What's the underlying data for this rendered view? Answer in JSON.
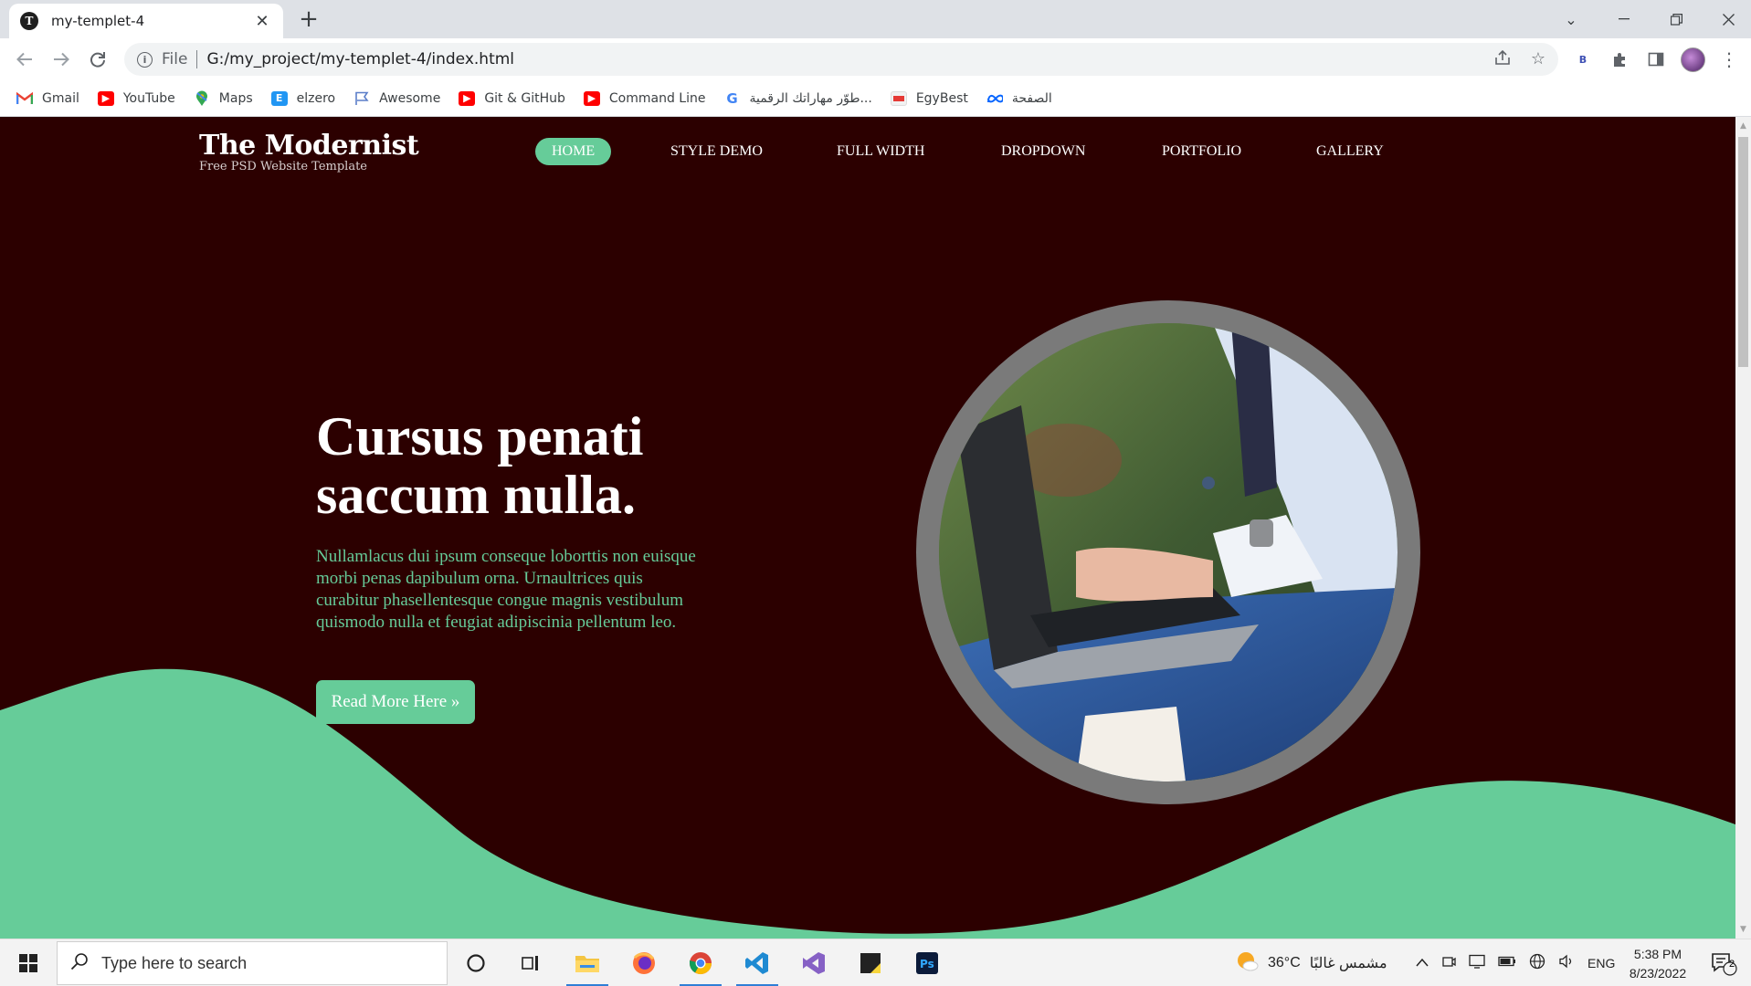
{
  "browser": {
    "tab_title": "my-templet-4",
    "tab_favicon_letter": "T",
    "url_scheme": "File",
    "url": "G:/my_project/my-templet-4/index.html",
    "extension_label": "B"
  },
  "bookmarks": [
    {
      "label": "Gmail",
      "icon": "gmail-icon"
    },
    {
      "label": "YouTube",
      "icon": "youtube-icon"
    },
    {
      "label": "Maps",
      "icon": "maps-icon"
    },
    {
      "label": "elzero",
      "icon": "elzero-icon"
    },
    {
      "label": "Awesome",
      "icon": "flag-icon"
    },
    {
      "label": "Git & GitHub",
      "icon": "youtube-icon"
    },
    {
      "label": "Command Line",
      "icon": "youtube-icon"
    },
    {
      "label": "طوّر مهاراتك الرقمية...",
      "icon": "google-icon"
    },
    {
      "label": "EgyBest",
      "icon": "egybest-icon"
    },
    {
      "label": "الصفحة",
      "icon": "meta-icon"
    }
  ],
  "site": {
    "logo_title": "The Modernist",
    "logo_subtitle": "Free PSD Website Template",
    "menu": [
      "HOME",
      "STYLE DEMO",
      "FULL WIDTH",
      "DROPDOWN",
      "PORTFOLIO",
      "GALLERY"
    ],
    "hero_title": "Cursus penati saccum nulla.",
    "hero_text": "Nullamlacus dui ipsum conseque loborttis non euisque morbi penas dapibulum orna. Urnaultrices quis curabitur phasellentesque congue magnis vestibulum quismodo nulla et feugiat adipiscinia pellentum leo.",
    "cta_label": "Read More Here »",
    "accent_color": "#66cc99",
    "background_color": "#2c0000"
  },
  "taskbar": {
    "search_placeholder": "Type here to search",
    "weather_temp": "36°C",
    "weather_text": "مشمس غالبًا",
    "language": "ENG",
    "time": "5:38 PM",
    "date": "8/23/2022",
    "notification_count": "2"
  }
}
